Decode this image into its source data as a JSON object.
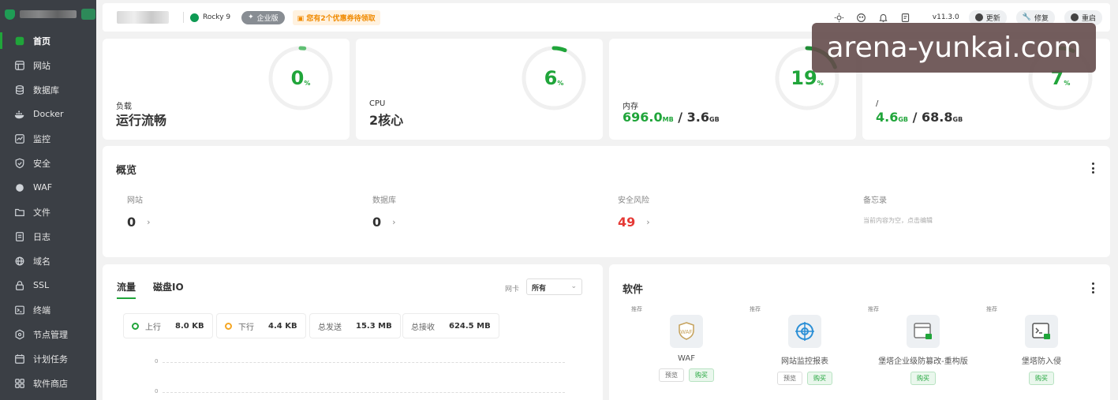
{
  "sidebar": {
    "items": [
      {
        "label": "首页",
        "icon": "home-icon",
        "active": true
      },
      {
        "label": "网站",
        "icon": "website-icon"
      },
      {
        "label": "数据库",
        "icon": "database-icon"
      },
      {
        "label": "Docker",
        "icon": "docker-icon"
      },
      {
        "label": "监控",
        "icon": "monitor-icon"
      },
      {
        "label": "安全",
        "icon": "shield-icon"
      },
      {
        "label": "WAF",
        "icon": "waf-icon"
      },
      {
        "label": "文件",
        "icon": "folder-icon"
      },
      {
        "label": "日志",
        "icon": "log-icon"
      },
      {
        "label": "域名",
        "icon": "domain-icon"
      },
      {
        "label": "SSL",
        "icon": "ssl-icon"
      },
      {
        "label": "终端",
        "icon": "terminal-icon"
      },
      {
        "label": "节点管理",
        "icon": "node-icon"
      },
      {
        "label": "计划任务",
        "icon": "calendar-icon"
      },
      {
        "label": "软件商店",
        "icon": "store-icon"
      }
    ]
  },
  "topbar": {
    "os": "Rocky 9",
    "edition": "企业版",
    "coupon": "您有2个优惠券待领取",
    "version": "v11.3.0",
    "update_label": "更新",
    "repair_label": "修复",
    "restart_label": "重启"
  },
  "stats": {
    "load": {
      "label": "负载",
      "value": "运行流畅",
      "gauge": "0",
      "unit": "%",
      "percent": 2
    },
    "cpu": {
      "label": "CPU",
      "value": "2核心",
      "gauge": "6",
      "unit": "%",
      "percent": 6
    },
    "memory": {
      "label": "内存",
      "used": "696.0",
      "used_unit": "MB",
      "slash": "/",
      "total": "3.6",
      "total_unit": "GB",
      "gauge": "19",
      "unit": "%",
      "percent": 19
    },
    "disk": {
      "label": "/",
      "used": "4.6",
      "used_unit": "GB",
      "slash": "/",
      "total": "68.8",
      "total_unit": "GB",
      "gauge": "7",
      "unit": "%",
      "percent": 7
    }
  },
  "overview": {
    "title": "概览",
    "items": [
      {
        "label": "网站",
        "value": "0",
        "arrow": "›"
      },
      {
        "label": "数据库",
        "value": "0",
        "arrow": "›"
      },
      {
        "label": "安全风险",
        "value": "49",
        "arrow": "›"
      },
      {
        "label": "备忘录",
        "memo": "当前内容为空，点击编辑"
      }
    ]
  },
  "traffic": {
    "tab_traffic": "流量",
    "tab_disk": "磁盘IO",
    "nic_label": "网卡",
    "nic_value": "所有",
    "stats": [
      {
        "label": "上行",
        "value": "8.0 KB"
      },
      {
        "label": "下行",
        "value": "4.4 KB"
      },
      {
        "label": "总发送",
        "value": "15.3 MB"
      },
      {
        "label": "总接收",
        "value": "624.5 MB"
      }
    ],
    "axis": [
      "0",
      "0"
    ]
  },
  "software": {
    "title": "软件",
    "items": [
      {
        "tag": "推荐",
        "name": "WAF",
        "preview": "预览",
        "buy": "购买"
      },
      {
        "tag": "推荐",
        "name": "网站监控报表",
        "preview": "预览",
        "buy": "购买"
      },
      {
        "tag": "推荐",
        "name": "堡塔企业级防篡改-重构版",
        "buy": "购买"
      },
      {
        "tag": "推荐",
        "name": "堡塔防入侵",
        "buy": "购买"
      }
    ]
  },
  "watermark": "arena-yunkai.com",
  "colors": {
    "accent": "#20a53a",
    "danger": "#e53935",
    "sidebar": "#3b3f45"
  }
}
